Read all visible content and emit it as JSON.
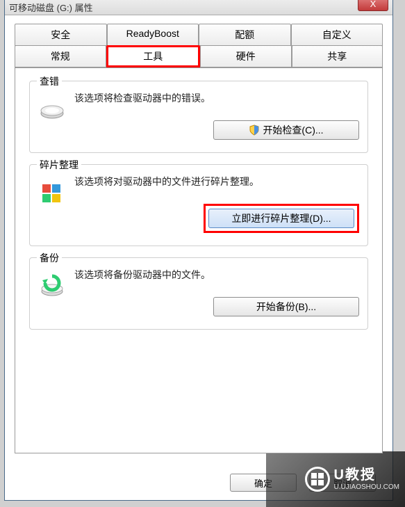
{
  "window": {
    "title": "可移动磁盘 (G:) 属性",
    "close": "X"
  },
  "tabs": {
    "row1": [
      "安全",
      "ReadyBoost",
      "配额",
      "自定义"
    ],
    "row2": [
      "常规",
      "工具",
      "硬件",
      "共享"
    ]
  },
  "groups": {
    "check": {
      "title": "查错",
      "desc": "该选项将检查驱动器中的错误。",
      "button": "开始检查(C)..."
    },
    "defrag": {
      "title": "碎片整理",
      "desc": "该选项将对驱动器中的文件进行碎片整理。",
      "button": "立即进行碎片整理(D)..."
    },
    "backup": {
      "title": "备份",
      "desc": "该选项将备份驱动器中的文件。",
      "button": "开始备份(B)..."
    }
  },
  "dialog": {
    "ok": "确定",
    "cancel": "取消"
  },
  "watermark": {
    "brand": "U教授",
    "url": "U.UJIAOSHOU.COM"
  }
}
